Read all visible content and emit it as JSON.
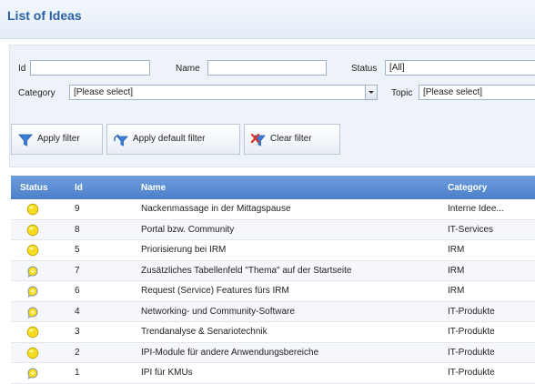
{
  "title": "List of Ideas",
  "filters": {
    "id_label": "Id",
    "id_value": "",
    "name_label": "Name",
    "name_value": "",
    "status_label": "Status",
    "status_value": "[All]",
    "category_label": "Category",
    "category_value": "[Please select]",
    "topic_label": "Topic",
    "topic_value": "[Please select]"
  },
  "buttons": {
    "apply_filter": "Apply filter",
    "apply_default_filter": "Apply default filter",
    "clear_filter": "Clear filter"
  },
  "colors": {
    "accent": "#2a61a6",
    "header": "#5a8ad2",
    "status_yellow": "#f5dc1e",
    "clear_red": "#d9342b"
  },
  "table": {
    "headers": [
      "Status",
      "Id",
      "Name",
      "Category"
    ],
    "rows": [
      {
        "status_icon": "yellow-bulb-icon",
        "id": "9",
        "name": "Nackenmassage in der Mittagspause",
        "category": "Interne Idee..."
      },
      {
        "status_icon": "yellow-bulb-icon",
        "id": "8",
        "name": "Portal bzw. Community",
        "category": "IT-Services"
      },
      {
        "status_icon": "yellow-bulb-icon",
        "id": "5",
        "name": "Priorisierung bei IRM",
        "category": "IRM"
      },
      {
        "status_icon": "comment-bulb-icon",
        "id": "7",
        "name": "Zusätzliches Tabellenfeld \"Thema\" auf der Startseite",
        "category": "IRM"
      },
      {
        "status_icon": "comment-bulb-icon",
        "id": "6",
        "name": "Request (Service) Features fürs IRM",
        "category": "IRM"
      },
      {
        "status_icon": "comment-bulb-icon",
        "id": "4",
        "name": "Networking- und Community-Software",
        "category": "IT-Produkte"
      },
      {
        "status_icon": "yellow-bulb-icon",
        "id": "3",
        "name": "Trendanalyse & Senariotechnik",
        "category": "IT-Produkte"
      },
      {
        "status_icon": "yellow-bulb-icon",
        "id": "2",
        "name": "IPI-Module für andere Anwendungsbereiche",
        "category": "IT-Produkte"
      },
      {
        "status_icon": "comment-bulb-icon",
        "id": "1",
        "name": "IPI für KMUs",
        "category": "IT-Produkte"
      }
    ]
  }
}
